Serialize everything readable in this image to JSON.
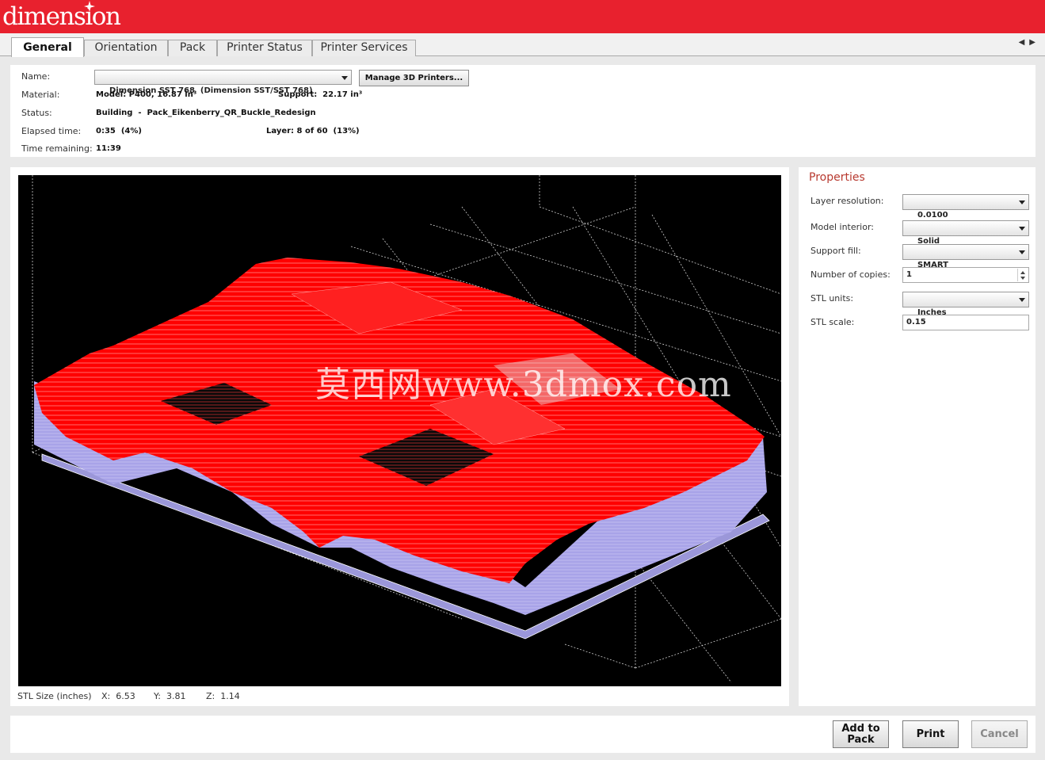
{
  "app": {
    "logo_text": "dimension",
    "brand_color": "#e8212e"
  },
  "tabs": [
    {
      "label": "General",
      "active": true
    },
    {
      "label": "Orientation",
      "active": false
    },
    {
      "label": "Pack",
      "active": false
    },
    {
      "label": "Printer Status",
      "active": false
    },
    {
      "label": "Printer Services",
      "active": false
    }
  ],
  "info": {
    "name_label": "Name:",
    "printer_name": "Dimension SST 768  (Dimension SST/SST 768)",
    "manage_button": "Manage 3D Printers...",
    "material_label": "Material:",
    "model_material": "Model: P400, 16.87 in³",
    "support_material": "Support:  22.17 in³",
    "status_label": "Status:",
    "status_value": "Building  -  Pack_Eikenberry_QR_Buckle_Redesign",
    "elapsed_label": "Elapsed time:",
    "elapsed_value": "0:35  (4%)",
    "layer_value": "Layer: 8 of 60  (13%)",
    "remaining_label": "Time remaining:",
    "remaining_value": "11:39"
  },
  "viewport": {
    "watermark": "莫西网www.3dmox.com",
    "model_color": "#ff0000",
    "support_color": "#a8a3e8"
  },
  "stl_size": {
    "label": "STL Size (inches)",
    "x": "X:  6.53",
    "y": "Y:  3.81",
    "z": "Z:  1.14"
  },
  "properties": {
    "title": "Properties",
    "layer_resolution_label": "Layer resolution:",
    "layer_resolution_value": "0.0100",
    "model_interior_label": "Model interior:",
    "model_interior_value": "Solid",
    "support_fill_label": "Support fill:",
    "support_fill_value": "SMART",
    "copies_label": "Number of copies:",
    "copies_value": "1",
    "stl_units_label": "STL units:",
    "stl_units_value": "Inches",
    "stl_scale_label": "STL scale:",
    "stl_scale_value": "0.15"
  },
  "actions": {
    "add_to_pack_line1": "Add to",
    "add_to_pack_line2": "Pack",
    "print": "Print",
    "cancel": "Cancel"
  }
}
